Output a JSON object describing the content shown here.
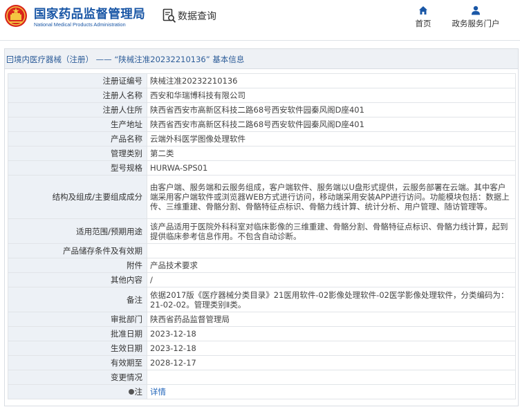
{
  "header": {
    "logo_cn": "国家药品监督管理局",
    "logo_en": "National Medical Products Administration",
    "emblem_icon": "national-emblem-icon",
    "query_label": "数据查询",
    "query_icon": "search-document-icon",
    "nav": [
      {
        "label": "首页",
        "icon": "home-icon"
      },
      {
        "label": "政务服务门户",
        "icon": "user-icon"
      }
    ]
  },
  "breadcrumb": {
    "icon": "document-icon",
    "category": "境内医疗器械（注册）",
    "separator": "——",
    "title": "“陕械注准20232210136” 基本信息"
  },
  "table": [
    {
      "label": "注册证编号",
      "value": "陕械注准20232210136"
    },
    {
      "label": "注册人名称",
      "value": "西安和华瑞博科技有限公司"
    },
    {
      "label": "注册人住所",
      "value": "陕西省西安市高新区科技二路68号西安软件园秦风阁D座401"
    },
    {
      "label": "生产地址",
      "value": "陕西省西安市高新区科技二路68号西安软件园秦风阁D座401"
    },
    {
      "label": "产品名称",
      "value": "云端外科医学图像处理软件"
    },
    {
      "label": "管理类别",
      "value": "第二类"
    },
    {
      "label": "型号规格",
      "value": "HURWA-SPS01"
    },
    {
      "label": "结构及组成/主要组成成分",
      "value": "由客户端、服务端和云服务组成，客户端软件、服务端以U盘形式提供，云服务部署在云端。其中客户端采用客户端软件或浏览器WEB方式进行访问，移动端采用安装APP进行访问。功能模块包括：数据上传、三维重建、骨骼分割、骨骼特征点标识、骨骼力线计算、统计分析、用户管理、随访管理等。"
    },
    {
      "label": "适用范围/预期用途",
      "value": "该产品适用于医院外科科室对临床影像的三维重建、骨骼分割、骨骼特征点标识、骨骼力线计算，起到提供临床参考信息作用。不包含自动诊断。"
    },
    {
      "label": "产品储存条件及有效期",
      "value": ""
    },
    {
      "label": "附件",
      "value": "产品技术要求"
    },
    {
      "label": "其他内容",
      "value": "/"
    },
    {
      "label": "备注",
      "value": "依据2017版《医疗器械分类目录》21医用软件-02影像处理软件-02医学影像处理软件，分类编码为：21-02-02。管理类别Ⅱ类。"
    },
    {
      "label": "审批部门",
      "value": "陕西省药品监督管理局"
    },
    {
      "label": "批准日期",
      "value": "2023-12-18"
    },
    {
      "label": "生效日期",
      "value": "2023-12-18"
    },
    {
      "label": "有效期至",
      "value": "2028-12-17"
    },
    {
      "label": "变更情况",
      "value": ""
    },
    {
      "label": "注",
      "value": "详情",
      "icon": "pin-icon"
    }
  ],
  "colors": {
    "brand": "#1a57a6",
    "label_bg": "#edf1f6",
    "breadcrumb_bg": "#eef1f5",
    "link": "#2266bb"
  }
}
